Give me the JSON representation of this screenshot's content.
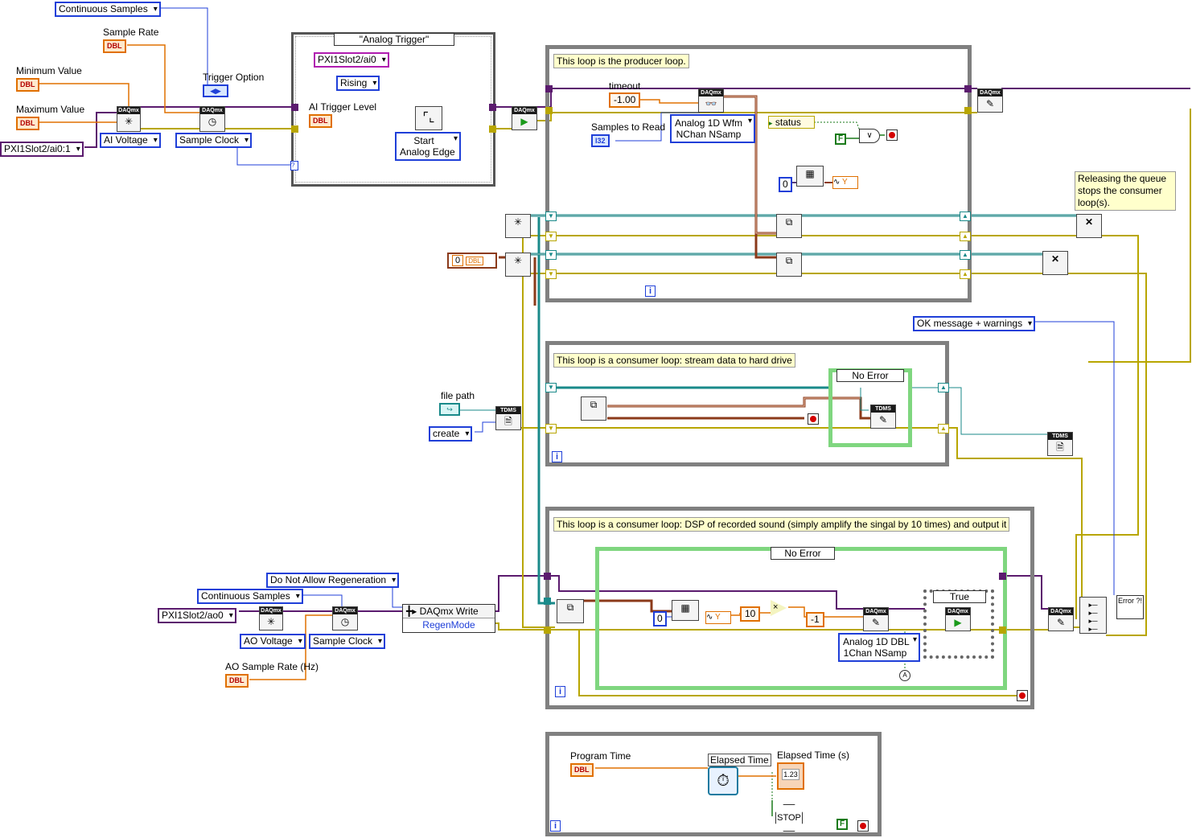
{
  "colors": {
    "dbl": "#e07000",
    "enum": "#1f3fd8",
    "daqmx_task": "#5b1b6e",
    "error": "#c8b800",
    "waveform": "#8b3a1a",
    "queue": "#1a8a8a",
    "loop": "#808080",
    "case": "#7fd67f",
    "bool": "#1a7a1a"
  },
  "top": {
    "continuous_samples": "Continuous Samples",
    "sample_rate": "Sample Rate",
    "minimum_value": "Minimum Value",
    "maximum_value": "Maximum Value",
    "trigger_option": "Trigger Option",
    "physical_channel": "PXI1Slot2/ai0:1",
    "ai_voltage": "AI Voltage",
    "sample_clock": "Sample Clock",
    "dbl": "DBL",
    "daqmx": "DAQmx"
  },
  "trigger_case": {
    "selector": "\"Analog Trigger\"",
    "source": "PXI1Slot2/ai0",
    "slope": "Rising",
    "level_label": "AI Trigger Level",
    "start_line1": "Start",
    "start_line2": "Analog Edge"
  },
  "producer": {
    "note": "This loop is the producer loop.",
    "timeout_label": "timeout",
    "timeout_value": "-1.00",
    "samples_label": "Samples to Read",
    "i32": "I32",
    "read_line1": "Analog 1D Wfm",
    "read_line2": "NChan NSamp",
    "status": "status",
    "index0": "0",
    "bool_f": "F",
    "iter": "i",
    "y": "Y"
  },
  "queue": {
    "zero": "0",
    "dbl": "DBL"
  },
  "release_note": "Releasing the queue stops the consumer loop(s).",
  "ok_message": "OK message + warnings",
  "consumer1": {
    "note": "This loop is a consumer loop: stream data to hard drive",
    "case": "No Error",
    "file_path": "file path",
    "create": "create",
    "tdms": "TDMS",
    "iter": "i"
  },
  "consumer2": {
    "note": "This loop is a consumer loop: DSP of recorded sound (simply amplify the singal by 10 times) and output it",
    "case": "No Error",
    "true_case": "True",
    "ten": "10",
    "neg1": "-1",
    "index0": "0",
    "y": "Y",
    "write_line1": "Analog 1D DBL",
    "write_line2": "1Chan NSamp",
    "iter": "i"
  },
  "ao": {
    "regen": "Do Not Allow Regeneration",
    "continuous": "Continuous Samples",
    "channel": "PXI1Slot2/ao0",
    "voltage": "AO Voltage",
    "sample_clock": "Sample Clock",
    "rate_label": "AO Sample Rate (Hz)",
    "write_node": "DAQmx Write",
    "regen_mode": "RegenMode"
  },
  "timer": {
    "program_time": "Program Time",
    "elapsed_label": "Elapsed Time",
    "elapsed_s": "Elapsed Time (s)",
    "indicator": "1.23",
    "stop": "STOP",
    "bool_f": "F",
    "iter": "i"
  },
  "error_handler": "Error ?!"
}
